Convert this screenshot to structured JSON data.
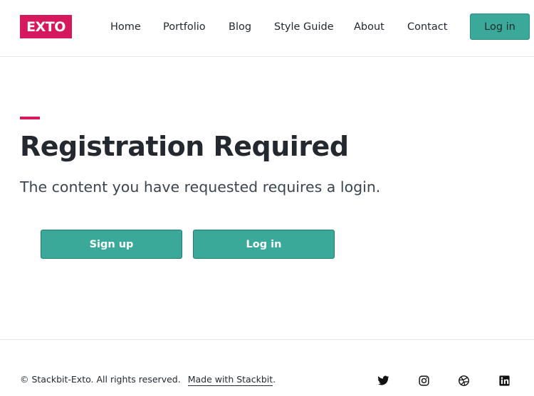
{
  "header": {
    "logo": "EXTO",
    "nav": [
      "Home",
      "Portfolio",
      "Blog",
      "Style Guide",
      "About",
      "Contact"
    ],
    "login_label": "Log in"
  },
  "main": {
    "title": "Registration Required",
    "subtitle": "The content you have requested requires a login.",
    "signup_label": "Sign up",
    "login_label": "Log in"
  },
  "footer": {
    "copyright": "© Stackbit-Exto. All rights reserved.",
    "made_with": "Made with Stackbit",
    "made_with_suffix": ".",
    "social_icons": [
      "twitter-icon",
      "instagram-icon",
      "dribbble-icon",
      "linkedin-icon"
    ]
  },
  "colors": {
    "accent": "#d6185e",
    "button": "#3aa99a",
    "text": "#23292f"
  }
}
